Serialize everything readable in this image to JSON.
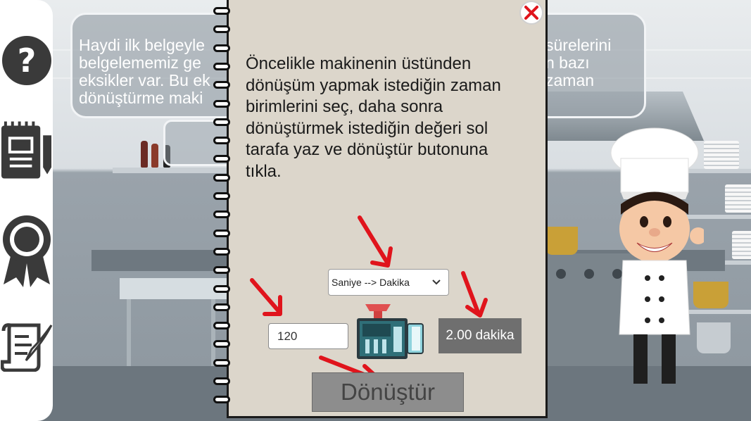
{
  "background": {
    "bubble_text_lines": [
      "Haydi ilk belgeyle",
      "belgelememiz ge",
      "eksikler var. Bu ek",
      "dönüştürme maki"
    ],
    "bubble_text_right_lines": [
      "sürelerini",
      "n bazı",
      "zaman"
    ]
  },
  "sidebar": {
    "icons": [
      "help-icon",
      "notebook-icon",
      "badge-icon",
      "scroll-icon"
    ]
  },
  "notebook": {
    "instruction": "Öncelikle makinenin üstünden dönüşüm yapmak istediğin zaman birimlerini seç, daha sonra dönüştürmek istediğin değeri sol tarafa yaz ve dönüştür butonuna tıkla.",
    "instruction_lines": [
      "Öncelikle makinenin üstünden",
      "dönüşüm yapmak istediğin zaman",
      "birimlerini seç, daha sonra",
      "dönüştürmek istediğin değeri sol",
      "tarafa yaz ve dönüştür butonuna",
      "tıkla."
    ],
    "unit_select_value": "Saniye --> Dakika",
    "input_value": "120",
    "output_value": "2.00 dakika",
    "convert_button_label": "Dönüştür",
    "close_icon": "close-icon"
  },
  "colors": {
    "arrow": "#e0141c",
    "close": "#e0141c",
    "notebook_paper": "#dcd6cb",
    "output_bg": "#6f6f6f"
  }
}
